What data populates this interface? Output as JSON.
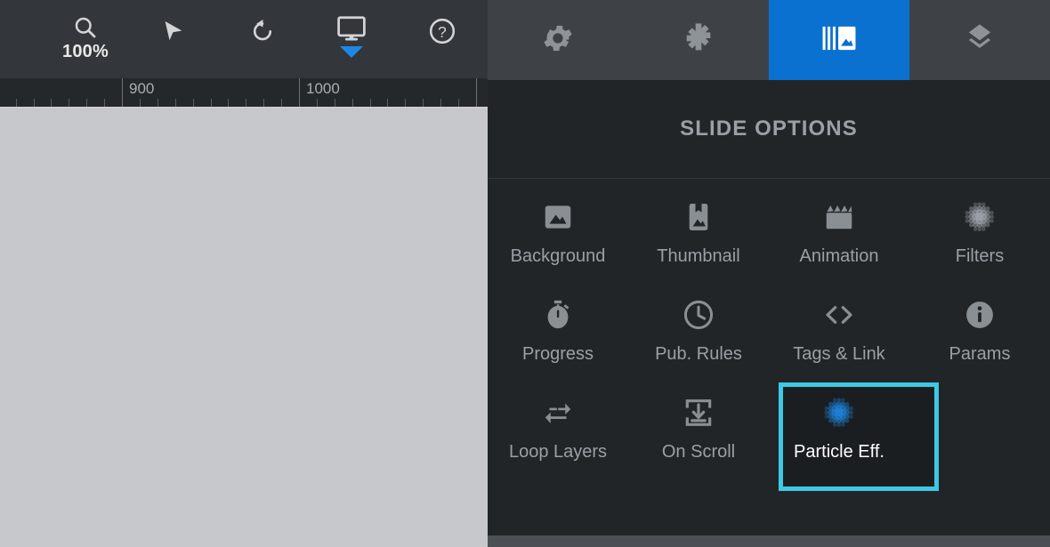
{
  "left_toolbar": {
    "items": [
      {
        "name": "zoom",
        "icon": "magnifier-icon",
        "label": "100%"
      },
      {
        "name": "select",
        "icon": "cursor-arrow-icon",
        "label": ""
      },
      {
        "name": "reset",
        "icon": "undo-rotate-icon",
        "label": ""
      },
      {
        "name": "preview",
        "icon": "monitor-icon",
        "label": ""
      },
      {
        "name": "help",
        "icon": "question-circle-icon",
        "label": ""
      }
    ],
    "zoom_level": "100%"
  },
  "ruler": {
    "labels": [
      "900",
      "1000"
    ],
    "major_positions": [
      137,
      336
    ],
    "minor_step": 19.9
  },
  "right_toolbar": {
    "tabs": [
      {
        "name": "settings",
        "icon": "gear-icon",
        "active": false
      },
      {
        "name": "layout",
        "icon": "move-cross-icon",
        "active": false
      },
      {
        "name": "slides",
        "icon": "slides-gallery-icon",
        "active": true
      },
      {
        "name": "layers",
        "icon": "layers-diamond-icon",
        "active": false
      }
    ],
    "active_color": "#0a71d0"
  },
  "panel": {
    "title": "SLIDE OPTIONS",
    "highlight_color": "#3fc8e4",
    "options": [
      {
        "label": "Background",
        "icon": "image-icon",
        "selected": false
      },
      {
        "label": "Thumbnail",
        "icon": "bookmark-image-icon",
        "selected": false
      },
      {
        "label": "Animation",
        "icon": "clapperboard-icon",
        "selected": false
      },
      {
        "label": "Filters",
        "icon": "dot-matrix-icon",
        "selected": false
      },
      {
        "label": "Progress",
        "icon": "stopwatch-icon",
        "selected": false
      },
      {
        "label": "Pub. Rules",
        "icon": "clock-icon",
        "selected": false
      },
      {
        "label": "Tags & Link",
        "icon": "code-brackets-icon",
        "selected": false
      },
      {
        "label": "Params",
        "icon": "info-circle-icon",
        "selected": false
      },
      {
        "label": "Loop Layers",
        "icon": "loop-one-icon",
        "selected": false
      },
      {
        "label": "On Scroll",
        "icon": "download-box-icon",
        "selected": false
      },
      {
        "label": "Particle Eff.",
        "icon": "dot-matrix-blue-icon",
        "selected": true
      }
    ]
  }
}
